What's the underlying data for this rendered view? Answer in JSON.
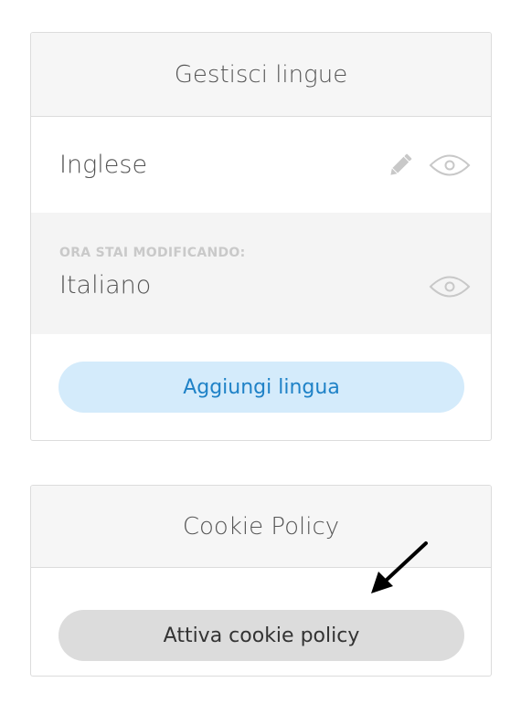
{
  "languages_panel": {
    "title": "Gestisci lingue",
    "languages": [
      {
        "name": "Inglese",
        "icons": [
          "pencil-icon",
          "eye-icon"
        ]
      },
      {
        "editing_label": "ORA STAI MODIFICANDO:",
        "name": "Italiano",
        "icons": [
          "eye-icon"
        ]
      }
    ],
    "add_button_label": "Aggiungi lingua"
  },
  "cookie_panel": {
    "title": "Cookie Policy",
    "enable_button_label": "Attiva cookie policy"
  },
  "colors": {
    "accent_blue": "#1f82c7",
    "add_button_bg": "#d4ebfb",
    "cookie_button_bg": "#dcdcdc",
    "header_bg": "#f6f6f6"
  }
}
